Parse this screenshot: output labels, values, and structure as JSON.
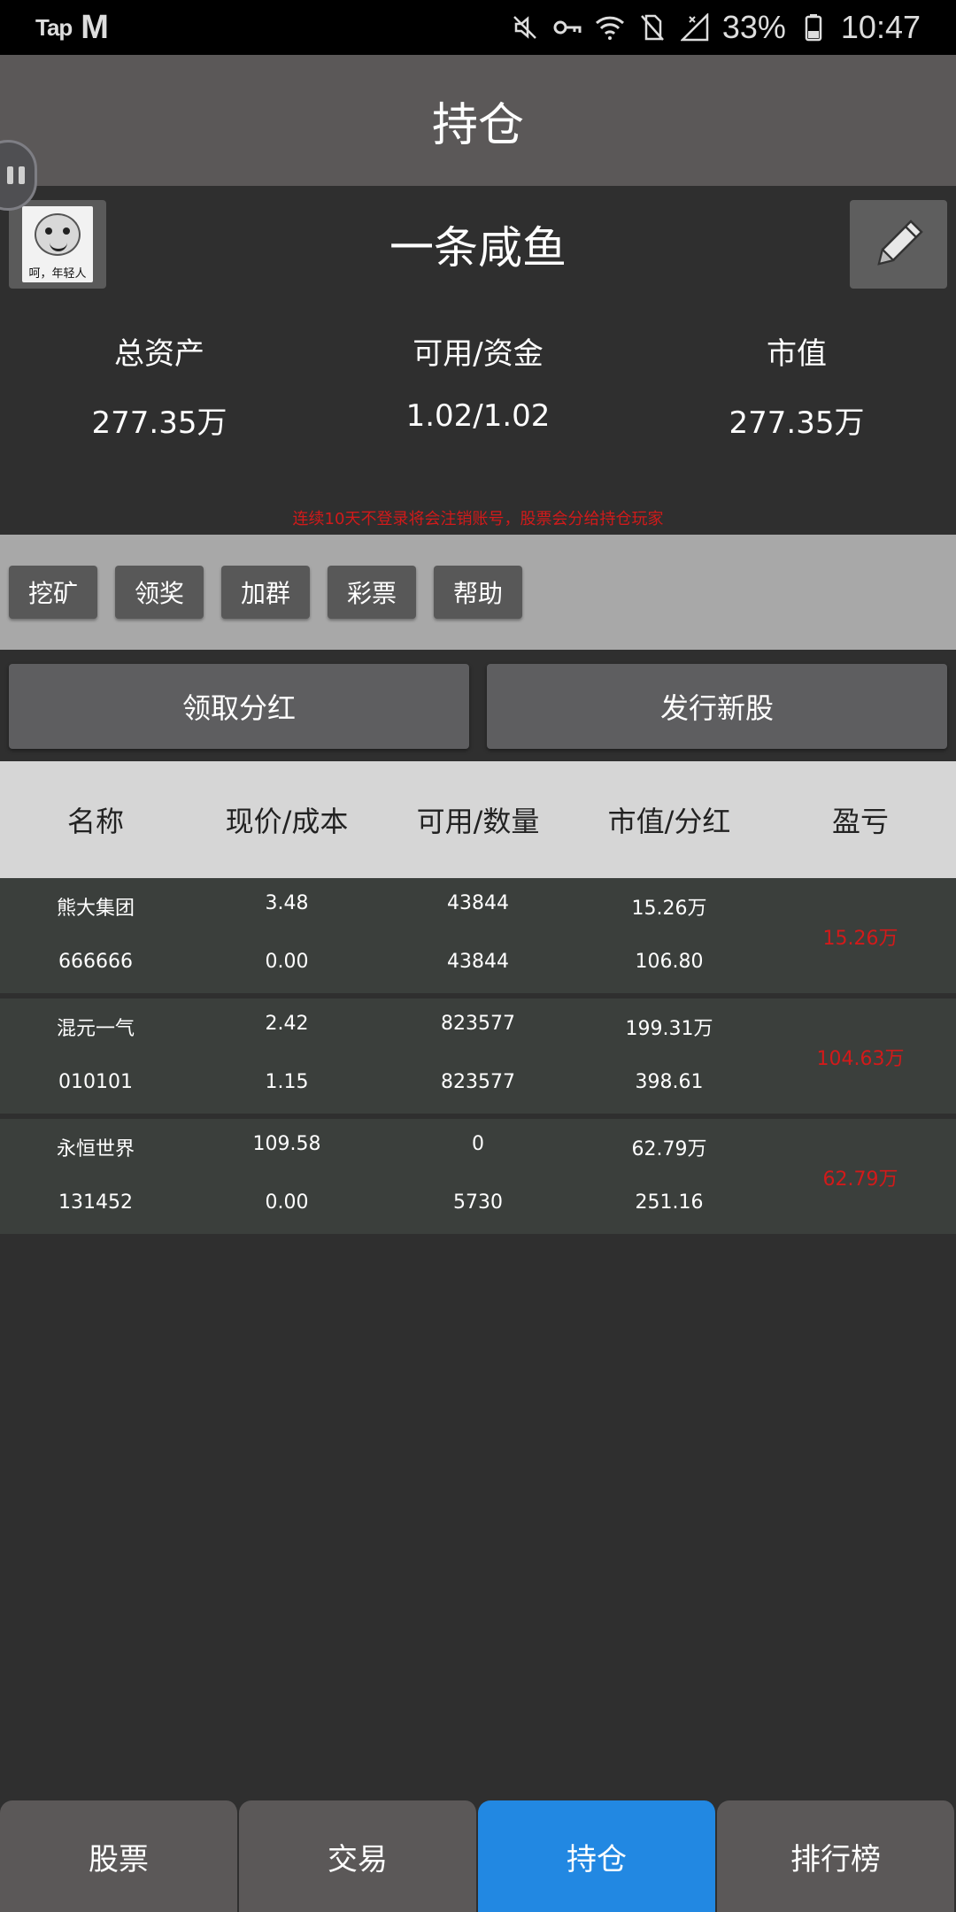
{
  "status_bar": {
    "app_logo_1": "Tap",
    "app_logo_2": "M",
    "battery": "33%",
    "time": "10:47",
    "icons": [
      "mute-icon",
      "vpn-key-icon",
      "wifi-icon",
      "no-sim-icon",
      "signal-icon",
      "battery-icon"
    ]
  },
  "header": {
    "title": "持仓"
  },
  "profile": {
    "avatar_caption": "呵，年轻人",
    "username": "一条咸鱼"
  },
  "summary": [
    {
      "label": "总资产",
      "value": "277.35万"
    },
    {
      "label": "可用/资金",
      "value": "1.02/1.02"
    },
    {
      "label": "市值",
      "value": "277.35万"
    }
  ],
  "warning": "连续10天不登录将会注销账号，股票会分给持仓玩家",
  "actions": [
    "挖矿",
    "领奖",
    "加群",
    "彩票",
    "帮助"
  ],
  "buttons": {
    "dividend": "领取分红",
    "issue": "发行新股"
  },
  "table": {
    "headers": [
      "名称",
      "现价/成本",
      "可用/数量",
      "市值/分红",
      "盈亏"
    ],
    "rows": [
      {
        "name": "熊大集团",
        "code": "666666",
        "price": "3.48",
        "cost": "0.00",
        "available": "43844",
        "quantity": "43844",
        "market_value": "15.26万",
        "dividend": "106.80",
        "pnl": "15.26万"
      },
      {
        "name": "混元一气",
        "code": "010101",
        "price": "2.42",
        "cost": "1.15",
        "available": "823577",
        "quantity": "823577",
        "market_value": "199.31万",
        "dividend": "398.61",
        "pnl": "104.63万"
      },
      {
        "name": "永恒世界",
        "code": "131452",
        "price": "109.58",
        "cost": "0.00",
        "available": "0",
        "quantity": "5730",
        "market_value": "62.79万",
        "dividend": "251.16",
        "pnl": "62.79万"
      }
    ]
  },
  "nav": [
    {
      "label": "股票",
      "active": false
    },
    {
      "label": "交易",
      "active": false
    },
    {
      "label": "持仓",
      "active": true
    },
    {
      "label": "排行榜",
      "active": false
    }
  ],
  "colors": {
    "accent": "#2288e2",
    "loss_profit": "#d21a1a",
    "title_bar": "#5b5858",
    "background": "#2f2f2f"
  }
}
